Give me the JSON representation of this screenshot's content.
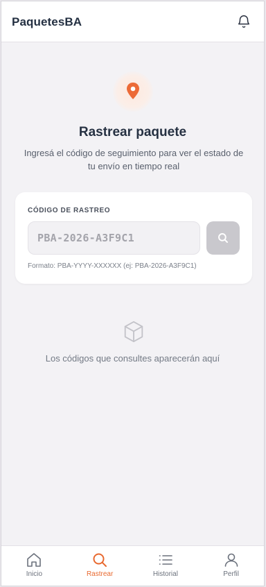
{
  "app": {
    "brand": "PaquetesBA",
    "notifications_icon": "bell-icon"
  },
  "hero": {
    "icon": "map-pin-icon",
    "title": "Rastrear paquete",
    "subtitle": "Ingresá el código de seguimiento para ver el estado de tu envío en tiempo real"
  },
  "tracking": {
    "label": "CÓDIGO DE RASTREO",
    "placeholder": "PBA-2026-A3F9C1",
    "value": "",
    "search_icon": "search-icon",
    "hint": "Formato: PBA-YYYY-XXXXXX (ej: PBA-2026-A3F9C1)"
  },
  "empty_state": {
    "icon": "box-icon",
    "text": "Los códigos que consultes aparecerán aquí"
  },
  "nav": {
    "items": [
      {
        "label": "Inicio",
        "icon": "home-icon",
        "active": false
      },
      {
        "label": "Rastrear",
        "icon": "search-icon",
        "active": true
      },
      {
        "label": "Historial",
        "icon": "list-icon",
        "active": false
      },
      {
        "label": "Perfil",
        "icon": "user-icon",
        "active": false
      }
    ]
  },
  "colors": {
    "accent": "#e8692f",
    "text_primary": "#263142",
    "background": "#f3f2f5",
    "button_disabled": "#c9c8cd"
  }
}
